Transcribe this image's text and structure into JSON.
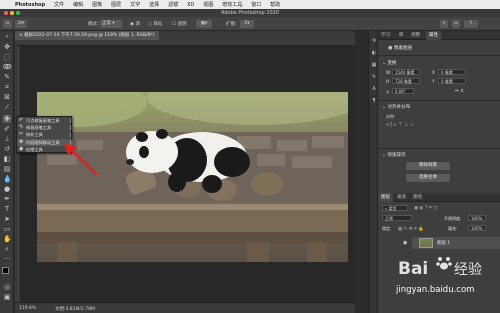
{
  "menubar": {
    "items": [
      "Photoshop",
      "文件",
      "编辑",
      "图像",
      "图层",
      "文字",
      "选择",
      "滤镜",
      "3D",
      "视图",
      "增效工具",
      "窗口",
      "帮助"
    ]
  },
  "window": {
    "title": "Adobe Photoshop 2020"
  },
  "options": {
    "mode_label": "模式：",
    "mode_value": "正常",
    "source_label": "源",
    "dest_label": "目标",
    "transparent_label": "透明",
    "diffuse_label": "扩散：",
    "diffuse_value": "5"
  },
  "document": {
    "tab_label": "截屏2022-07-14 下午7.59.59.png @ 119% (图层 1, RGB/8*)",
    "zoom": "119.6%",
    "doc_size": "文档:3.81M/2.78M"
  },
  "flyout": {
    "items": [
      {
        "icon": "spot-healing-icon",
        "label": "污点修复画笔工具",
        "shortcut": "J",
        "selected": false
      },
      {
        "icon": "healing-brush-icon",
        "label": "修复画笔工具",
        "shortcut": "J",
        "selected": false
      },
      {
        "icon": "patch-icon",
        "label": "修补工具",
        "shortcut": "J",
        "selected": false
      },
      {
        "icon": "content-aware-move-icon",
        "label": "内容感知移动工具",
        "shortcut": "J",
        "selected": true
      },
      {
        "icon": "red-eye-icon",
        "label": "红眼工具",
        "shortcut": "J",
        "selected": false
      }
    ]
  },
  "right_panel": {
    "tabs": [
      "学习",
      "库",
      "调整",
      "属性"
    ],
    "active_tab": "属性",
    "pixel_layer_label": "像素图层",
    "transform_label": "变换",
    "w_value": "1540 像素",
    "h_value": "728 像素",
    "x_label": "X",
    "x_value": "0 像素",
    "y_label": "Y",
    "y_value": "0 像素",
    "angle_value": "0.00°",
    "align_label": "对齐并分布",
    "align_sub": "对齐:",
    "quick_actions_label": "快速操作",
    "remove_bg_label": "移除背景",
    "select_subject_label": "选择主体",
    "layers_tabs": [
      "图层",
      "通道",
      "路径"
    ],
    "layer_filter": "类型",
    "blend_mode": "正常",
    "opacity_label": "不透明度:",
    "opacity_value": "100%",
    "lock_label": "锁定:",
    "fill_label": "填充:",
    "fill_value": "100%",
    "layer_name": "图层 1"
  },
  "watermark": {
    "brand": "Bai",
    "brand2": "经验",
    "url": "jingyan.baidu.com"
  },
  "colors": {
    "arrow": "#e02020",
    "accent": "#1473e6"
  }
}
